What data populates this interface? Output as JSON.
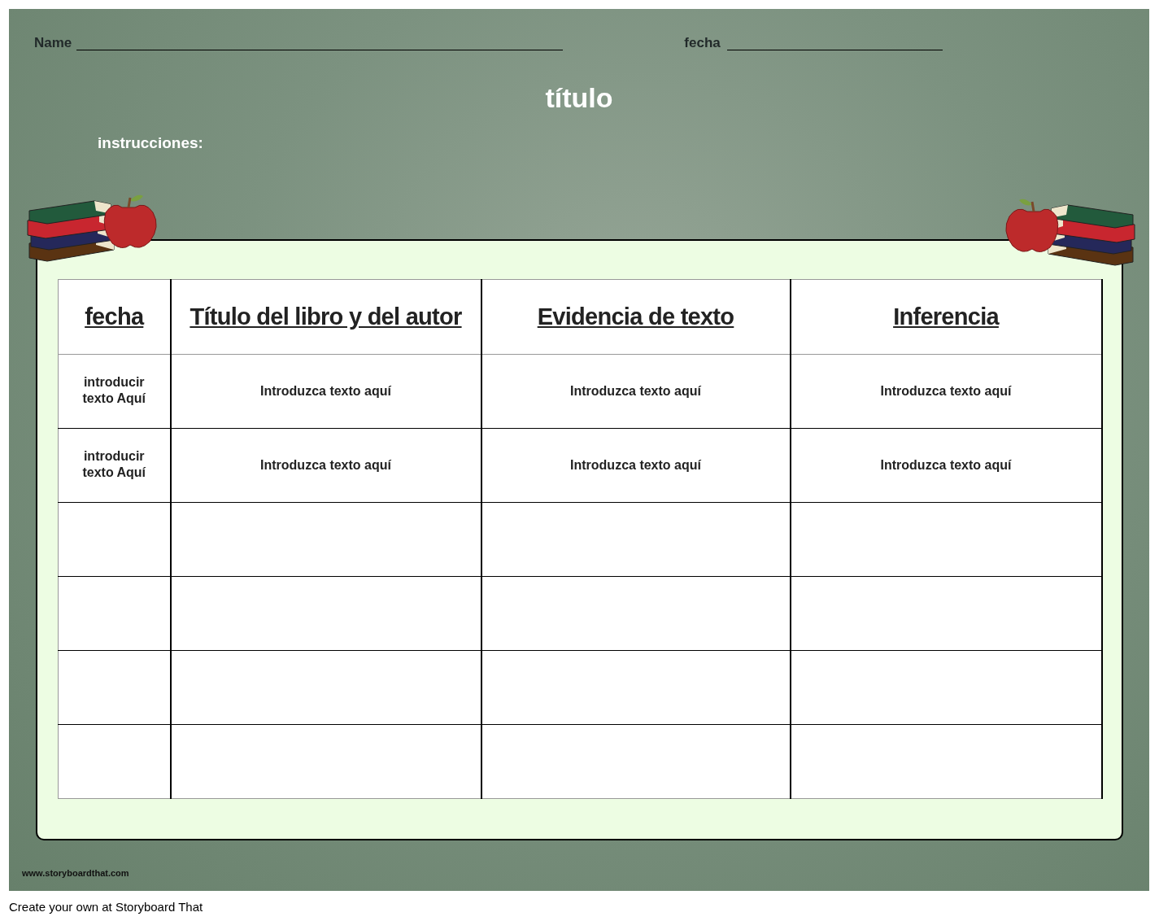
{
  "header": {
    "name_label": "Name",
    "date_label": "fecha"
  },
  "title": "título",
  "instructions_label": "instrucciones:",
  "table": {
    "columns": [
      "fecha",
      "Título del libro y del autor",
      "Evidencia de texto",
      "Inferencia"
    ],
    "rows": [
      {
        "kind": "filled",
        "cells": [
          "introducir texto Aquí",
          "Introduzca texto aquí",
          "Introduzca texto aquí",
          "Introduzca texto aquí"
        ]
      },
      {
        "kind": "filled",
        "cells": [
          "introducir texto Aquí",
          "Introduzca texto aquí",
          "Introduzca texto aquí",
          "Introduzca texto aquí"
        ]
      },
      {
        "kind": "blank"
      },
      {
        "kind": "blank"
      },
      {
        "kind": "blank"
      },
      {
        "kind": "blank"
      }
    ]
  },
  "footer_url": "www.storyboardthat.com",
  "caption": "Create your own at Storyboard That"
}
